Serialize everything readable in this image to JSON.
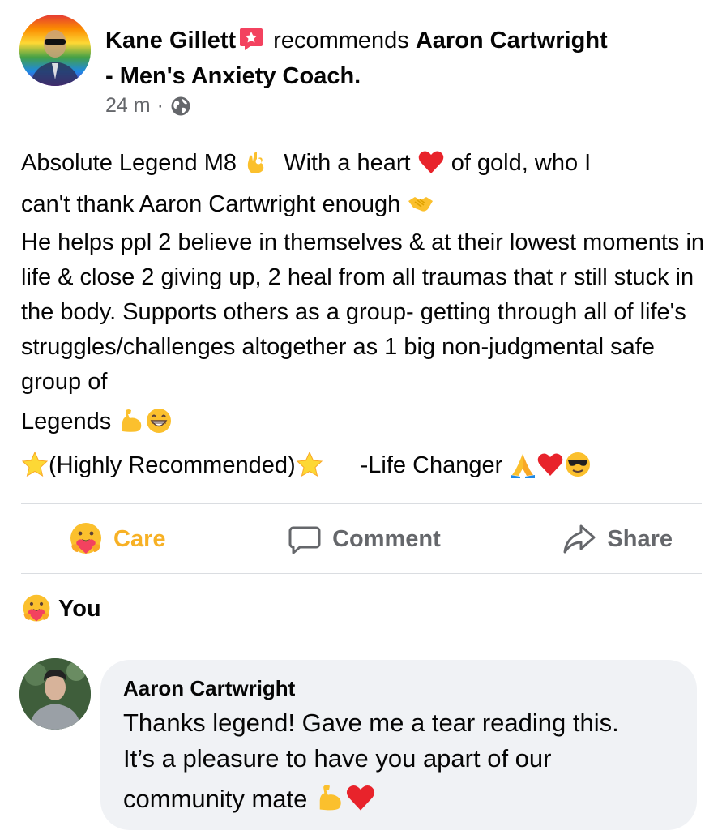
{
  "post": {
    "author_name": "Kane Gillett",
    "verb": "recommends",
    "recommended_page_line1": "Aaron Cartwright",
    "recommended_page_line2": "- Men's Anxiety Coach.",
    "time": "24 m",
    "separator": "·",
    "privacy_icon": "globe-icon",
    "body": {
      "line1_a": "Absolute Legend M8",
      "line1_b": "With a heart",
      "line1_c": "of gold, who I",
      "line2": "can't thank Aaron Cartwright enough",
      "paragraph": "He helps ppl 2 believe in themselves & at their lowest moments in life & close 2 giving up, 2 heal from all traumas that r still stuck in the body. Supports others as a group- getting through all of life's struggles/challenges altogether as 1 big non-judgmental safe group of",
      "legends": "Legends",
      "highly_recommended": "(Highly Recommended)",
      "life_changer": "-Life Changer"
    },
    "emoji_icons": [
      "ok-hand-icon",
      "red-heart-icon",
      "handshake-icon",
      "flexed-biceps-icon",
      "grinning-face-icon",
      "star-icon",
      "folded-hands-icon",
      "sunglasses-face-icon"
    ]
  },
  "actions": {
    "care_label": "Care",
    "comment_label": "Comment",
    "share_label": "Share"
  },
  "reactions": {
    "who": "You",
    "icon": "care-reaction-icon"
  },
  "comment": {
    "author": "Aaron Cartwright",
    "text_line1": "Thanks legend! Gave me a tear reading this.",
    "text_line2": "It’s a pleasure to have you apart of our",
    "text_line3": "community mate"
  },
  "colors": {
    "care_accent": "#f7b125",
    "secondary_text": "#65676b",
    "bubble_bg": "#f0f2f5",
    "badge_pink": "#f3425f"
  }
}
